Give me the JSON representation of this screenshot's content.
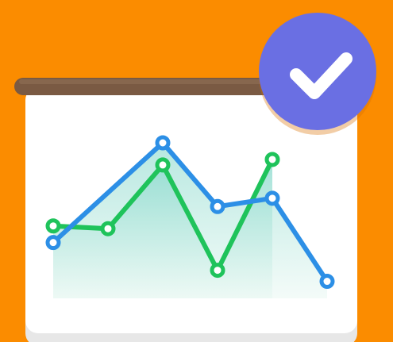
{
  "colors": {
    "background": "#FB8C00",
    "board": "#FFFFFF",
    "board_shadow": "#E7E7E7",
    "rail": "#7A5A43",
    "rail_highlight": "#94735A",
    "badge": "#6A6FE3",
    "badge_shadow": "#D96F00",
    "check": "#FFFFFF",
    "series_green": "#1FC35B",
    "series_blue": "#2C8FE6",
    "area_top": "#7FD6C8",
    "area_bottom": "#EAF8F3"
  },
  "icons": {
    "badge": "check-icon",
    "board": "presentation-board-icon"
  },
  "chart_data": {
    "type": "line",
    "x": [
      1,
      2,
      3,
      4,
      5
    ],
    "series": [
      {
        "values": [
          2.5,
          2.4,
          4.7,
          0.9,
          4.9
        ],
        "x": [
          1,
          2,
          3,
          4,
          5
        ]
      },
      {
        "values": [
          1.9,
          5.5,
          3.2,
          3.5,
          0.5
        ],
        "x": [
          1,
          3,
          4,
          5,
          6
        ]
      }
    ],
    "grid": false,
    "legend": "none"
  }
}
